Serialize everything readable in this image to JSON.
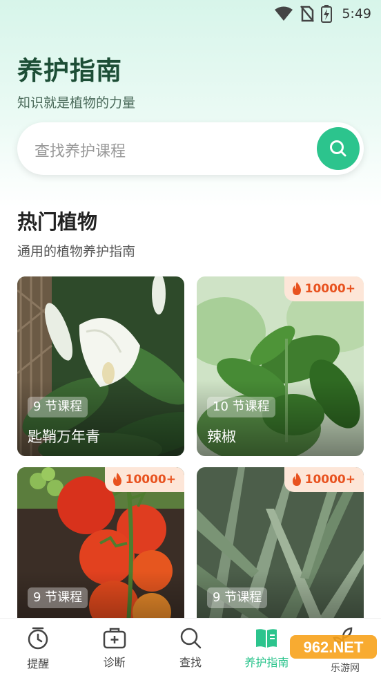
{
  "status_bar": {
    "time": "5:49",
    "icons": [
      "wifi-icon",
      "no-sim-icon",
      "battery-charging-icon"
    ]
  },
  "header": {
    "title": "养护指南",
    "subtitle": "知识就是植物的力量"
  },
  "search": {
    "placeholder": "查找养护课程",
    "icon": "search-icon"
  },
  "section": {
    "title": "热门植物",
    "subtitle": "通用的植物养护指南"
  },
  "cards": [
    {
      "name": "匙鞘万年青",
      "lessons": "9 节课程",
      "hot": ""
    },
    {
      "name": "辣椒",
      "lessons": "10 节课程",
      "hot": "10000+"
    },
    {
      "name": "",
      "lessons": "9 节课程",
      "hot": "10000+"
    },
    {
      "name": "",
      "lessons": "9 节课程",
      "hot": "10000+"
    }
  ],
  "tabs": [
    {
      "label": "提醒",
      "icon": "clock-icon",
      "active": false
    },
    {
      "label": "诊断",
      "icon": "medical-kit-icon",
      "active": false
    },
    {
      "label": "查找",
      "icon": "search-icon",
      "active": false
    },
    {
      "label": "养护指南",
      "icon": "book-icon",
      "active": true
    },
    {
      "label": "",
      "icon": "plant-icon",
      "active": false
    }
  ],
  "colors": {
    "accent": "#2cc48d",
    "title": "#1d4e36",
    "hot_text": "#e8521f",
    "hot_bg": "#fde6d8"
  },
  "watermark": {
    "text": "962.NET",
    "sub": "乐游网"
  }
}
